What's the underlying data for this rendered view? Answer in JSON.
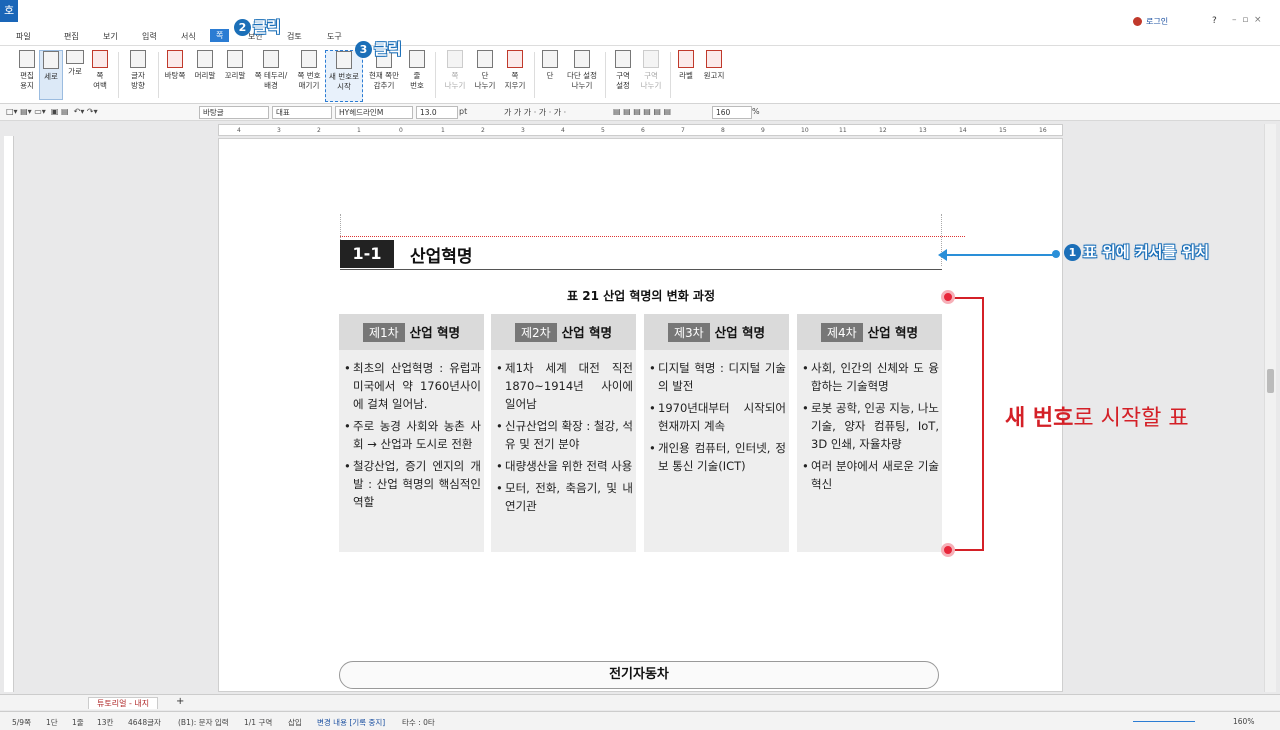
{
  "app": {
    "logo": "호"
  },
  "titlebar": {
    "login": "로그인",
    "help": "?"
  },
  "menu": {
    "items": [
      "파일",
      "편집",
      "보기",
      "입력",
      "서식",
      "쪽",
      "보안",
      "검토",
      "도구"
    ]
  },
  "ribbon": {
    "buttons": [
      {
        "label": "편집\n용지",
        "name": "edit-paper"
      },
      {
        "label": "세로",
        "name": "portrait"
      },
      {
        "label": "가로",
        "name": "landscape"
      },
      {
        "label": "쪽\n여백",
        "name": "page-margin"
      },
      {
        "label": "글자\n방향",
        "name": "text-direction"
      },
      {
        "label": "바탕쪽",
        "name": "master-page"
      },
      {
        "label": "머리말",
        "name": "header"
      },
      {
        "label": "꼬리말",
        "name": "footer"
      },
      {
        "label": "쪽 테두리/\n배경",
        "name": "page-border"
      },
      {
        "label": "쪽 번호\n매기기",
        "name": "page-number"
      },
      {
        "label": "새 번호로\n시작",
        "name": "new-number-start"
      },
      {
        "label": "현재 쪽만\n감추기",
        "name": "hide-current-page"
      },
      {
        "label": "줄\n번호",
        "name": "line-number"
      },
      {
        "label": "쪽\n나누기",
        "name": "page-break"
      },
      {
        "label": "단\n나누기",
        "name": "column-break"
      },
      {
        "label": "쪽\n지우기",
        "name": "delete-page"
      },
      {
        "label": "단",
        "name": "columns"
      },
      {
        "label": "다단 설정\n나누기",
        "name": "multi-column"
      },
      {
        "label": "구역\n설정",
        "name": "section-setting"
      },
      {
        "label": "구역\n나누기",
        "name": "section-break"
      },
      {
        "label": "라벨",
        "name": "label"
      },
      {
        "label": "원고지",
        "name": "manuscript"
      }
    ]
  },
  "formatbar": {
    "style": "바탕글",
    "lang": "대표",
    "font": "HY헤드라인M",
    "size": "13.0",
    "unit": "pt",
    "zoom_value": "160",
    "zoom_unit": "%"
  },
  "ruler": {
    "numbers": [
      "4",
      "3",
      "2",
      "1",
      "0",
      "1",
      "2",
      "3",
      "4",
      "5",
      "6",
      "7",
      "8",
      "9",
      "10",
      "11",
      "12",
      "13",
      "14",
      "15",
      "16"
    ]
  },
  "document": {
    "heading_num": "1-1",
    "heading_title": "산업혁명",
    "table_caption": "표 21 산업 혁명의 변화 과정",
    "columns": [
      {
        "badge": "제1차",
        "title": "산업 혁명",
        "items": [
          "최초의 산업혁명 : 유럽과 미국에서 약 1760년사이에 걸쳐 일어남.",
          "주로 농경 사회와 농촌 사회 → 산업과 도시로 전환",
          "철강산업, 증기 엔지의 개발 : 산업 혁명의 핵심적인 역할"
        ]
      },
      {
        "badge": "제2차",
        "title": "산업 혁명",
        "items": [
          "제1차 세계 대전 직전 1870~1914년 사이에 일어남",
          "신규산업의 확장 : 철강, 석유 및 전기 분야",
          "대량생산을 위한 전력 사용",
          "모터, 전화, 축음기, 및 내연기관"
        ]
      },
      {
        "badge": "제3차",
        "title": "산업 혁명",
        "items": [
          "디지털 혁명 : 디지털 기술의 발전",
          "1970년대부터 시작되어 현재까지 계속",
          "개인용 컴퓨터, 인터넷, 정보 통신 기술(ICT)"
        ]
      },
      {
        "badge": "제4차",
        "title": "산업 혁명",
        "items": [
          "사회, 인간의 신체와 도 융합하는 기술혁명",
          "로봇 공학, 인공 지능, 나노 기술, 양자 컴퓨팅, IoT, 3D 인쇄, 자율차량",
          "여러 분야에서 새로운 기술 혁신"
        ]
      }
    ],
    "bottom_box": "전기자동차"
  },
  "annotations": {
    "step1_num": "1",
    "step1_text": "표 위에 커서를 위치",
    "step2_num": "2",
    "step2_text": "클릭",
    "step3_num": "3",
    "step3_text": "클릭",
    "new_number_bold": "새 번호",
    "new_number_rest": "로 시작할 표"
  },
  "tabs": {
    "doc_tab": "튜토리얼 - 내지",
    "add": "+"
  },
  "status": {
    "page": "5/9쪽",
    "col": "1단",
    "line": "1줄",
    "char": "13칸",
    "count": "4648글자",
    "input": "(B1): 문자 입력",
    "section": "1/1 구역",
    "mode": "삽입",
    "track": "변경 내용 [기록 중지]",
    "typo": "타수 : 0타",
    "zoom": "160%"
  }
}
